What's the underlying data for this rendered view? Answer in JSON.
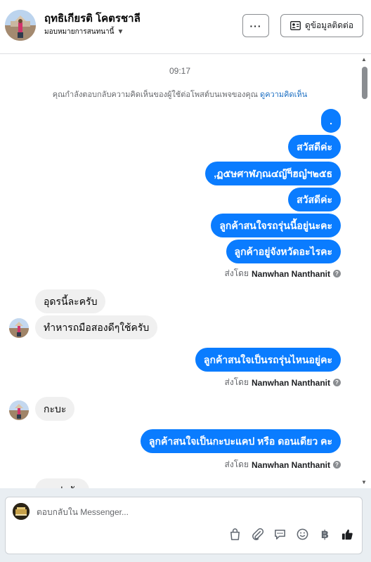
{
  "header": {
    "user_name": "ฤทธิเกียรติ โคตรชาลี",
    "assignment": "มอบหมายการสนทนานี้",
    "more_label": "···",
    "contact_label": "ดูข้อมูลติดต่อ"
  },
  "thread": {
    "time": "09:17",
    "context_text": "คุณกำลังตอบกลับความคิดเห็นของผู้ใช้ต่อโพสต์บนเพจของคุณ",
    "context_link": "ดูความคิดเห็น",
    "sent_by_prefix": "ส่งโดย",
    "sender_name": "Nanwhan Nanthanit",
    "group1": [
      ".",
      "สวัสดีค่ะ",
      ",ฏ๕ษศาฬฦณ๔ญ๊ฯ็ฮญ๋ฯ๒๕ธ",
      "สวัสดีค่ะ",
      "ลูกค้าสนใจรถรุ่นนี้อยู่นะคะ",
      "ลูกค้าอยู่จังหวัดอะไรคะ"
    ],
    "incoming1": [
      "อุดรนี้ละครับ",
      "ทำหารถมือสองดีๆใช้ครับ"
    ],
    "outgoing2": "ลูกค้าสนใจเป็นรถรุ่นไหนอยู่คะ",
    "incoming2": "กะบะ",
    "outgoing3": "ลูกค้าสนใจเป็นกะบะแคป หรือ ดอนเดียว คะ",
    "incoming3_partial": "แคปครับ"
  },
  "composer": {
    "placeholder": "ตอบกลับใน Messenger...",
    "tools": [
      "shopping-bag-icon",
      "paperclip-icon",
      "saved-reply-icon",
      "emoji-icon",
      "baht-icon",
      "like-icon"
    ],
    "baht_glyph": "฿"
  },
  "colors": {
    "outgoing_bubble": "#0a7cff",
    "incoming_bubble": "#f0f0f0",
    "link": "#1b6ec2"
  }
}
